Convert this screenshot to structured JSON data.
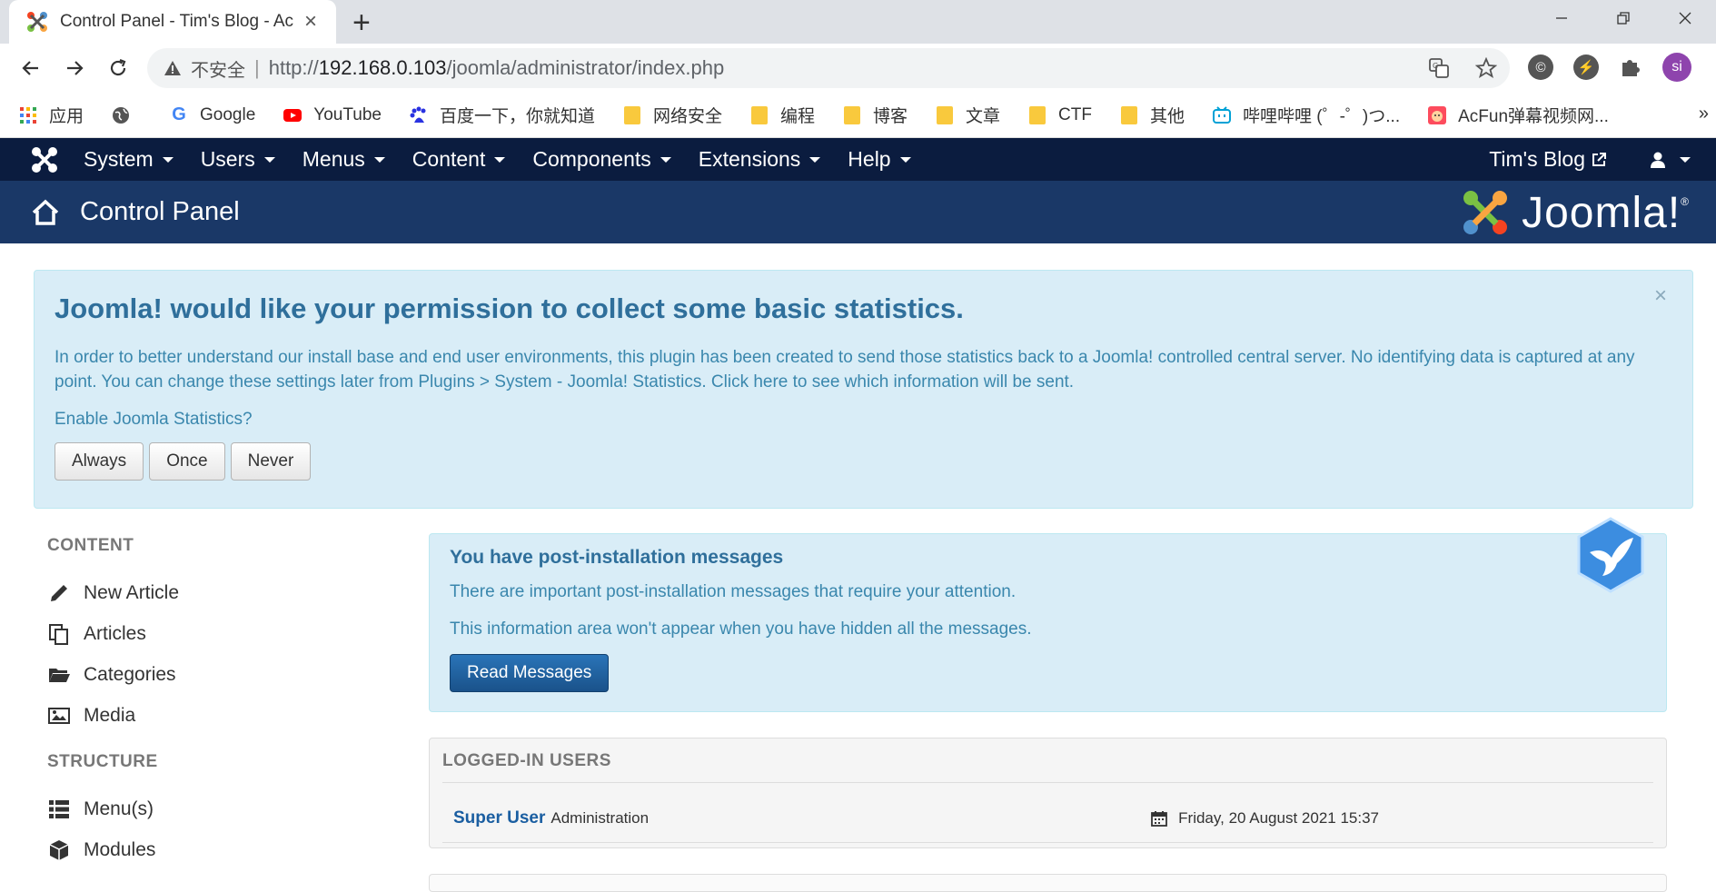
{
  "browser": {
    "tab_title": "Control Panel - Tim's Blog - Ac",
    "tab_close": "×",
    "new_tab": "+",
    "not_secure": "不安全",
    "url_prefix": "http://",
    "url_host": "192.168.0.103",
    "url_path": "/joomla/administrator/index.php",
    "avatar_initials": "si",
    "bookmarks": [
      {
        "label": "应用",
        "icon": "apps-grid-icon"
      },
      {
        "label": "",
        "icon": "globe-icon"
      },
      {
        "label": "Google",
        "icon": "google-icon"
      },
      {
        "label": "YouTube",
        "icon": "youtube-icon"
      },
      {
        "label": "百度一下，你就知道",
        "icon": "baidu-icon"
      },
      {
        "label": "网络安全",
        "icon": "folder-icon"
      },
      {
        "label": "编程",
        "icon": "folder-icon"
      },
      {
        "label": "博客",
        "icon": "folder-icon"
      },
      {
        "label": "文章",
        "icon": "folder-icon"
      },
      {
        "label": "CTF",
        "icon": "folder-icon"
      },
      {
        "label": "其他",
        "icon": "folder-icon"
      },
      {
        "label": "哔哩哔哩 (゜-゜)つ...",
        "icon": "bilibili-icon"
      },
      {
        "label": "AcFun弹幕视频网...",
        "icon": "acfun-icon"
      }
    ],
    "bookmarks_more": "»"
  },
  "joomla": {
    "menu": [
      "System",
      "Users",
      "Menus",
      "Content",
      "Components",
      "Extensions",
      "Help"
    ],
    "site_link": "Tim's Blog",
    "page_title": "Control Panel",
    "brand": "Joomla!",
    "brand_reg": "®"
  },
  "stats_alert": {
    "close": "×",
    "heading": "Joomla! would like your permission to collect some basic statistics.",
    "body": "In order to better understand our install base and end user environments, this plugin has been created to send those statistics back to a Joomla! controlled central server. No identifying data is captured at any point. You can change these settings later from Plugins > System - Joomla! Statistics. Click here to see which information will be sent.",
    "question": "Enable Joomla Statistics?",
    "buttons": [
      "Always",
      "Once",
      "Never"
    ]
  },
  "sidebar": {
    "content_heading": "CONTENT",
    "content_items": [
      "New Article",
      "Articles",
      "Categories",
      "Media"
    ],
    "structure_heading": "STRUCTURE",
    "structure_items": [
      "Menu(s)",
      "Modules"
    ]
  },
  "postinstall": {
    "heading": "You have post-installation messages",
    "line1": "There are important post-installation messages that require your attention.",
    "line2": "This information area won't appear when you have hidden all the messages.",
    "button": "Read Messages"
  },
  "logged_in": {
    "heading": "LOGGED-IN USERS",
    "user": "Super User",
    "role": "Administration",
    "date": "Friday, 20 August 2021 15:37"
  },
  "colors": {
    "joomla_nav": "#0b1c3f",
    "joomla_subhead": "#1a3867",
    "alert_bg": "#d9edf7",
    "primary_button": "#1a528a"
  }
}
